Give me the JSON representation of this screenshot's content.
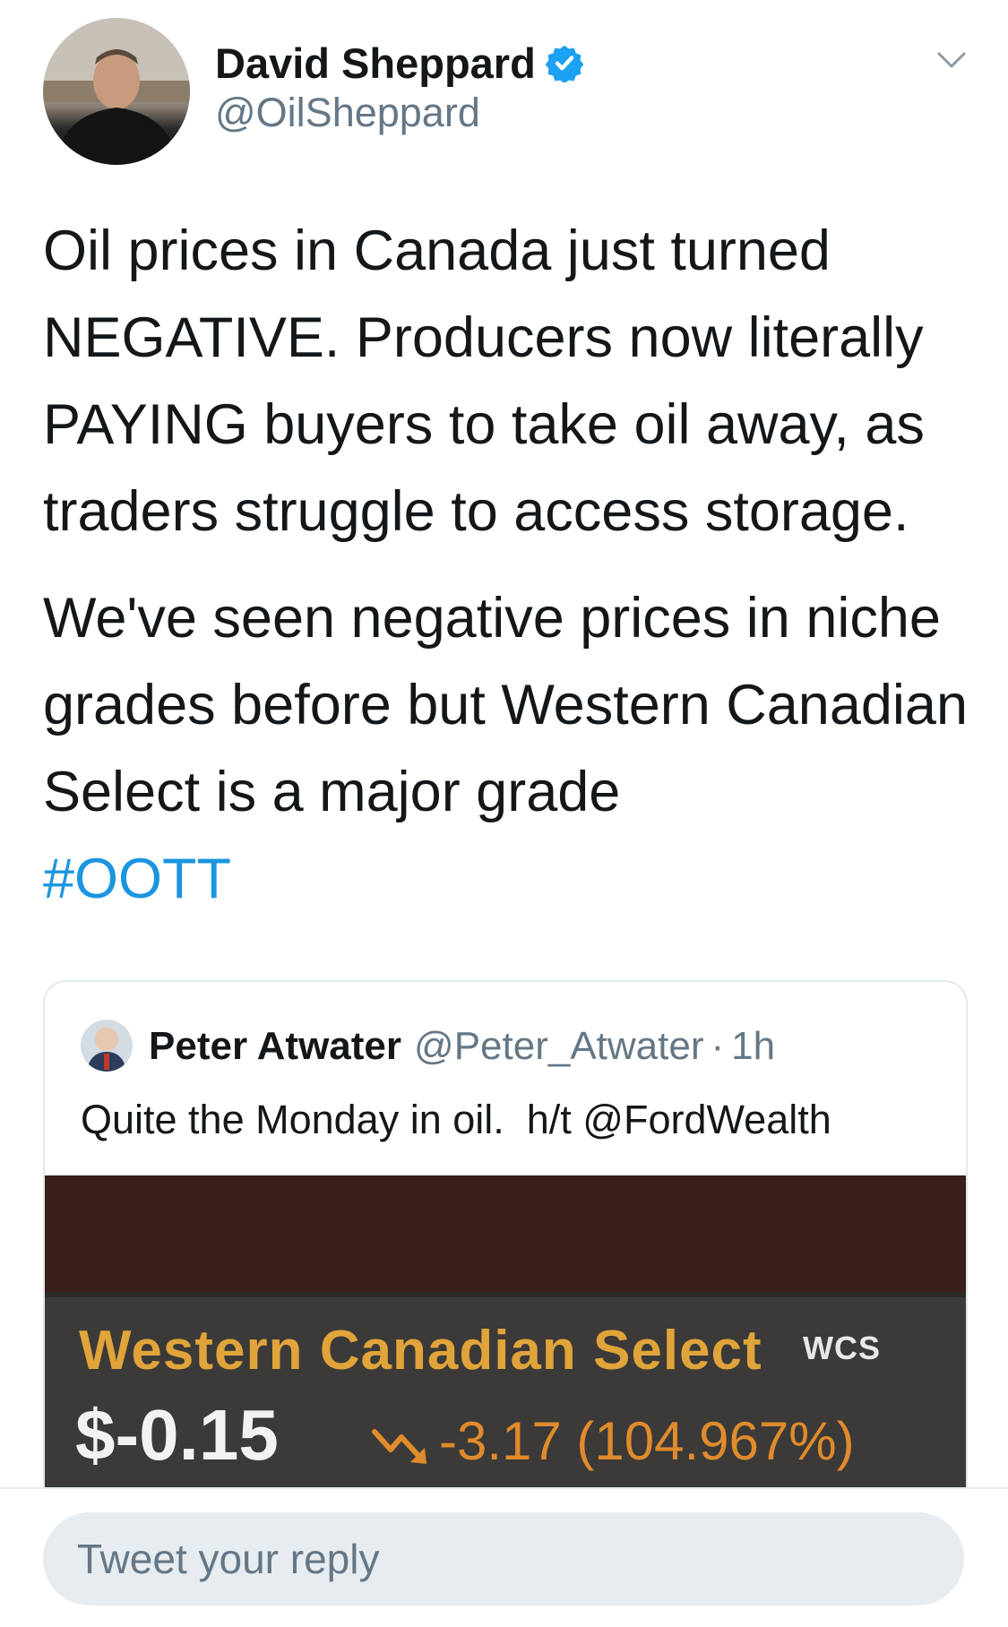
{
  "tweet": {
    "author": {
      "display_name": "David Sheppard",
      "handle": "@OilSheppard",
      "verified": true
    },
    "paragraphs": [
      "Oil prices in Canada just turned NEGATIVE. Producers now literally PAYING buyers to take oil away, as traders struggle to access storage.",
      "We've seen negative prices in niche grades before but Western Canadian Select is a major grade"
    ],
    "hashtag": "#OOTT"
  },
  "quoted_tweet": {
    "display_name": "Peter Atwater",
    "handle": "@Peter_Atwater",
    "separator": "·",
    "time": "1h",
    "text": "Quite the Monday in oil.  h/t @FordWealth",
    "image": {
      "title": "Western Canadian Select",
      "ticker": "WCS",
      "price": "$-0.15",
      "change": "-3.17 (104.967%)"
    }
  },
  "reply": {
    "placeholder": "Tweet your reply"
  },
  "colors": {
    "link": "#1b95e0",
    "secondary_text": "#657786",
    "verified_badge": "#1da1f2",
    "wcs_title": "#e0a43a",
    "wcs_change": "#e08b2c"
  },
  "icons": {
    "verified": "verified-badge-icon",
    "caret": "chevron-down-icon",
    "trend": "trend-down-arrow-icon"
  }
}
